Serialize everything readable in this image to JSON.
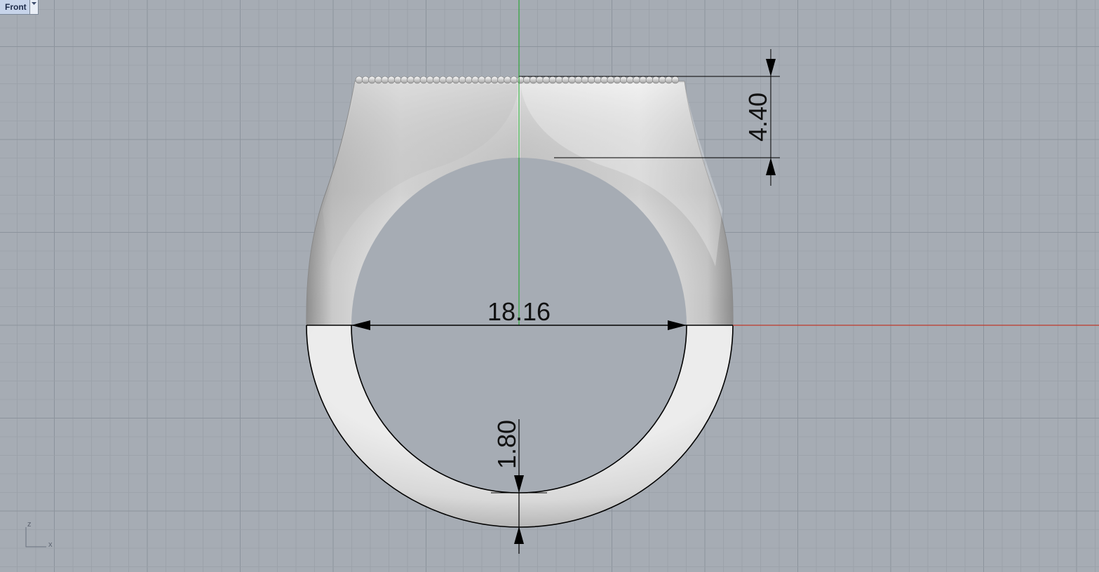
{
  "viewport": {
    "name": "Front",
    "menu_icon": "chevron-down-icon"
  },
  "axes": {
    "x_label": "x",
    "z_label": "z",
    "x_color": "#c0392b",
    "y_color": "#2fa53b"
  },
  "dimensions": {
    "inner_diameter": "18.16",
    "top_height": "4.40",
    "shank_thickness": "1.80"
  },
  "colors": {
    "background": "#a6acb4",
    "grid_minor": "#9aa0a8",
    "grid_major": "#8c939c",
    "ring_light": "#f2f2f2",
    "ring_dark": "#9a9a9a",
    "dimension": "#000000"
  }
}
